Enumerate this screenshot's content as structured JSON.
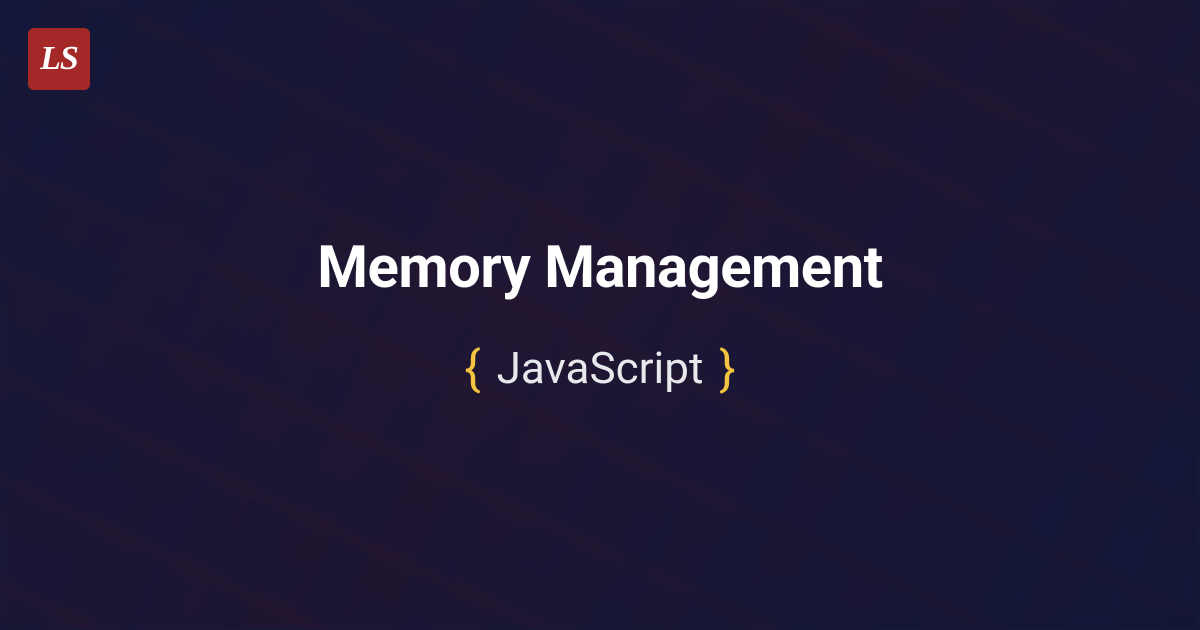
{
  "logo": {
    "text": "LS"
  },
  "hero": {
    "title": "Memory Management",
    "subtitle": "JavaScript",
    "brace_open": "{",
    "brace_close": "}"
  },
  "colors": {
    "logo_bg": "#a42828",
    "brace": "#f5c542",
    "title": "#ffffff"
  }
}
